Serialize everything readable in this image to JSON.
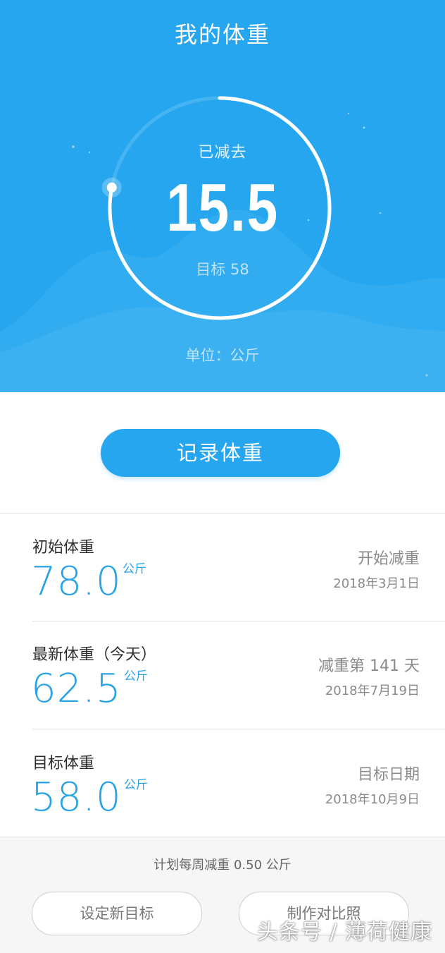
{
  "header": {
    "title": "我的体重",
    "lost_label": "已减去",
    "lost_value": "15.5",
    "target_label": "目标 58",
    "unit_label": "单位：公斤",
    "progress": 0.78
  },
  "record_button": {
    "label": "记录体重"
  },
  "rows": [
    {
      "name": "初始体重",
      "value": "78.0",
      "unit": "公斤",
      "right_title": "开始减重",
      "right_date": "2018年3月1日"
    },
    {
      "name": "最新体重（今天）",
      "value": "62.5",
      "unit": "公斤",
      "right_title": "减重第 141 天",
      "right_date": "2018年7月19日"
    },
    {
      "name": "目标体重",
      "value": "58.0",
      "unit": "公斤",
      "right_title": "目标日期",
      "right_date": "2018年10月9日"
    }
  ],
  "footer": {
    "plan": "计划每周减重 0.50 公斤",
    "set_goal_label": "设定新目标",
    "compare_label": "制作对比照"
  },
  "watermark": "头条号 / 薄荷健康",
  "colors": {
    "primary": "#26a6ef",
    "value_blue": "#2aa3e6",
    "footer_bg": "#f6f6f7"
  }
}
